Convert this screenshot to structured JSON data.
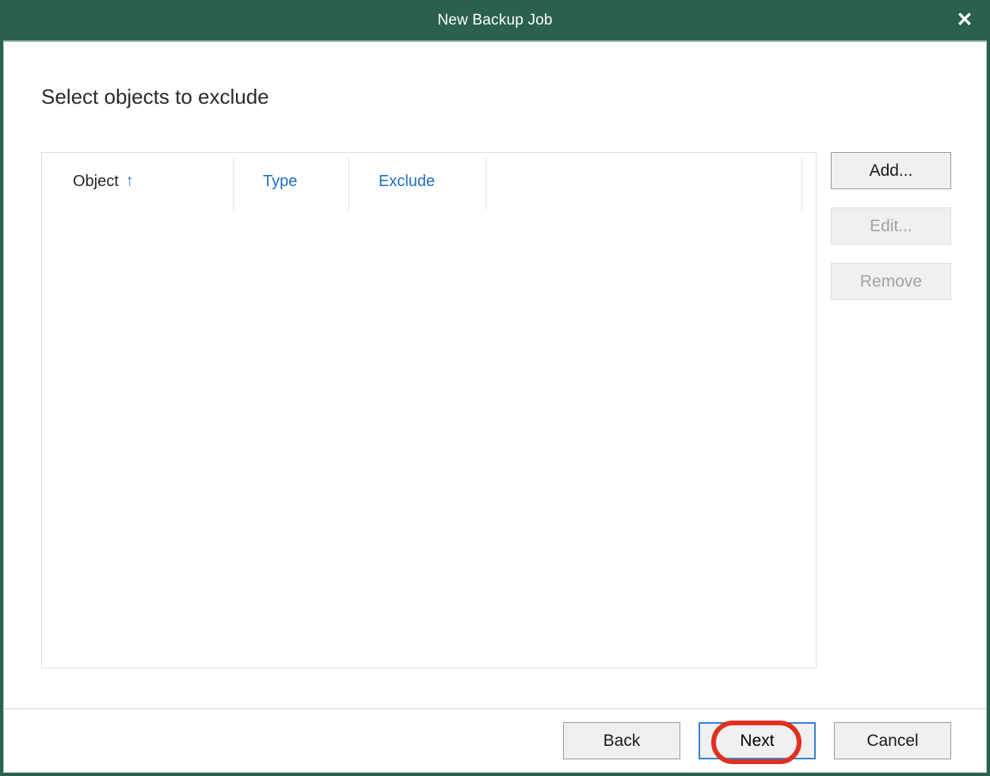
{
  "window": {
    "title": "New Backup Job",
    "close_icon": "close-icon",
    "close_glyph": "✕",
    "accent_color": "#2b6050",
    "frame_color": "#2b6050"
  },
  "page": {
    "heading": "Select objects to exclude"
  },
  "table": {
    "columns": [
      {
        "label": "Object",
        "sorted": true,
        "sort_glyph": "↑",
        "color": "#252525"
      },
      {
        "label": "Type",
        "sorted": false,
        "color": "#1c6fc4"
      },
      {
        "label": "Exclude",
        "sorted": false,
        "color": "#1c6fc4"
      }
    ],
    "rows": [],
    "empty": true
  },
  "side_buttons": [
    {
      "label": "Add...",
      "enabled": true
    },
    {
      "label": "Edit...",
      "enabled": false
    },
    {
      "label": "Remove",
      "enabled": false
    }
  ],
  "footer_buttons": [
    {
      "label": "Back",
      "focused": false
    },
    {
      "label": "Next",
      "focused": true
    },
    {
      "label": "Cancel",
      "focused": false
    }
  ],
  "annotation": {
    "shape": "oval",
    "color": "#e03020",
    "targets": "Next"
  }
}
